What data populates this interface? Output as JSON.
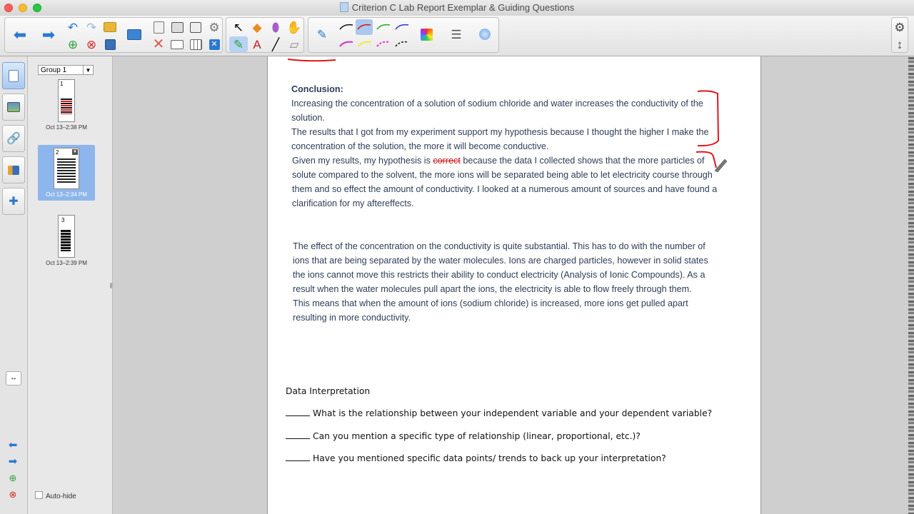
{
  "window": {
    "title": "Criterion C Lab Report Exemplar & Guiding Questions"
  },
  "toolbar": {
    "icons": [
      "back-arrow",
      "forward-arrow",
      "undo",
      "redo",
      "open-folder",
      "add-page",
      "delete-page",
      "save",
      "screen-shade",
      "paste",
      "delete",
      "display-toggle",
      "table",
      "magic-pen",
      "select",
      "shapes",
      "eraser",
      "fill",
      "pen",
      "text",
      "line",
      "highlighter",
      "pen-styles",
      "color-palette",
      "line-properties",
      "gallery-object"
    ],
    "accent": "#2a79cf"
  },
  "sorter": {
    "group_label": "Group 1",
    "pages": [
      {
        "number": "1",
        "timestamp": "Oct 13–2:38 PM"
      },
      {
        "number": "2",
        "timestamp": "Oct 13–2:34 PM"
      },
      {
        "number": "3",
        "timestamp": "Oct 13–2:39 PM"
      }
    ],
    "auto_hide_label": "Auto-hide"
  },
  "document": {
    "conclusion_heading": "Conclusion:",
    "para1_line1": "Increasing the concentration of a solution of sodium chloride and water increases the conductivity of the solution.",
    "para1_line2": "The results that I got from my experiment support my hypothesis because I thought the higher I make the concentration of the solution, the more it will become conductive.",
    "para1_pre_strike": "Given my results, my hypothesis is ",
    "para1_strike": "correct",
    "para1_post_strike": " because the data I collected shows that the more particles of solute compared to the solvent, the more ions will be separated being able to let electricity course through them and so effect the amount of conductivity. I looked at a numerous amount of sources and have found a clarification for my aftereffects.",
    "para2": "The effect of the concentration on the conductivity is quite substantial. This has to do with the number of ions that are being separated by the water molecules. Ions are charged particles, however in solid states the ions cannot move this restricts their ability to conduct electricity (Analysis of Ionic Compounds). As a result when the water molecules pull apart the ions, the electricity is able to flow freely through them. This means that when the amount of ions (sodium chloride) is increased, more ions get pulled apart resulting in more conductivity.",
    "data_heading": "Data Interpretation",
    "questions": [
      "What is the relationship between your independent variable and your dependent variable?",
      "Can you mention a specific type of relationship (linear, proportional, etc.)?",
      "Have you mentioned specific data points/ trends to back up your interpretation?"
    ]
  },
  "annotation_color": "#e0161b"
}
